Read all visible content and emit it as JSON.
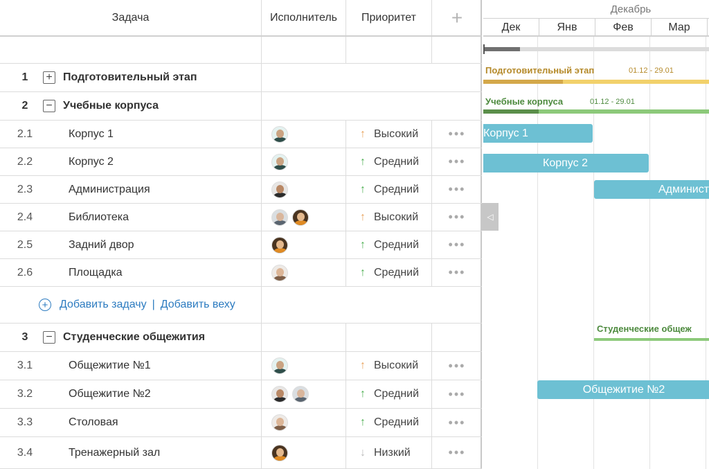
{
  "columns": {
    "task": "Задача",
    "assignee": "Исполнитель",
    "priority": "Приоритет",
    "add": "+"
  },
  "groups": [
    {
      "num": "1",
      "toggle": "+",
      "title": "Подготовительный этап"
    },
    {
      "num": "2",
      "toggle": "−",
      "title": "Учебные корпуса"
    },
    {
      "num": "3",
      "toggle": "−",
      "title": "Студенческие общежития"
    }
  ],
  "tasks": [
    {
      "num": "2.1",
      "title": "Корпус 1",
      "priority": "Высокий",
      "arrow": "↑",
      "arrow_color": "#e8a35c",
      "avatars": [
        "teal"
      ]
    },
    {
      "num": "2.2",
      "title": "Корпус 2",
      "priority": "Средний",
      "arrow": "↑",
      "arrow_color": "#4caf50",
      "avatars": [
        "teal"
      ]
    },
    {
      "num": "2.3",
      "title": "Администрация",
      "priority": "Средний",
      "arrow": "↑",
      "arrow_color": "#4caf50",
      "avatars": [
        "dark"
      ]
    },
    {
      "num": "2.4",
      "title": "Библиотека",
      "priority": "Высокий",
      "arrow": "↑",
      "arrow_color": "#e8a35c",
      "avatars": [
        "gray",
        "curly"
      ]
    },
    {
      "num": "2.5",
      "title": "Задний двор",
      "priority": "Средний",
      "arrow": "↑",
      "arrow_color": "#4caf50",
      "avatars": [
        "curly"
      ]
    },
    {
      "num": "2.6",
      "title": "Площадка",
      "priority": "Средний",
      "arrow": "↑",
      "arrow_color": "#4caf50",
      "avatars": [
        "light"
      ]
    },
    {
      "num": "3.1",
      "title": "Общежитие №1",
      "priority": "Высокий",
      "arrow": "↑",
      "arrow_color": "#e8a35c",
      "avatars": [
        "teal"
      ]
    },
    {
      "num": "3.2",
      "title": "Общежитие №2",
      "priority": "Средний",
      "arrow": "↑",
      "arrow_color": "#4caf50",
      "avatars": [
        "dark",
        "gray"
      ]
    },
    {
      "num": "3.3",
      "title": "Столовая",
      "priority": "Средний",
      "arrow": "↑",
      "arrow_color": "#4caf50",
      "avatars": [
        "light"
      ]
    },
    {
      "num": "3.4",
      "title": "Тренажерный зал",
      "priority": "Низкий",
      "arrow": "↓",
      "arrow_color": "#bbbbbb",
      "avatars": [
        "curly"
      ]
    }
  ],
  "row_actions": "•••",
  "add_row": {
    "add_task": "Добавить задачу",
    "separator": "|",
    "add_milestone": "Добавить веху"
  },
  "gantt": {
    "month": "Декабрь",
    "scale": [
      "Дек",
      "Янв",
      "Фев",
      "Мар"
    ],
    "group_bars": [
      {
        "label": "Подготовительный этап",
        "dates": "01.12 - 29.01",
        "color": "#b58a2a",
        "track_color": "#f2d16b",
        "progress_color": "#d4a84a"
      },
      {
        "label": "Учебные корпуса",
        "dates": "01.12 - 29.01",
        "color": "#4d8a3e",
        "track_color": "#8cc97a",
        "progress_color": "#5b8f4a"
      },
      {
        "label": "Студенческие общеж",
        "dates": "",
        "color": "#4d8a3e",
        "track_color": "#8cc97a",
        "progress_color": "#8cc97a"
      }
    ],
    "task_bars": [
      "Корпус 1",
      "Корпус 2",
      "Администрация",
      "Общежитие №2"
    ],
    "collapse_icon": "◁"
  }
}
